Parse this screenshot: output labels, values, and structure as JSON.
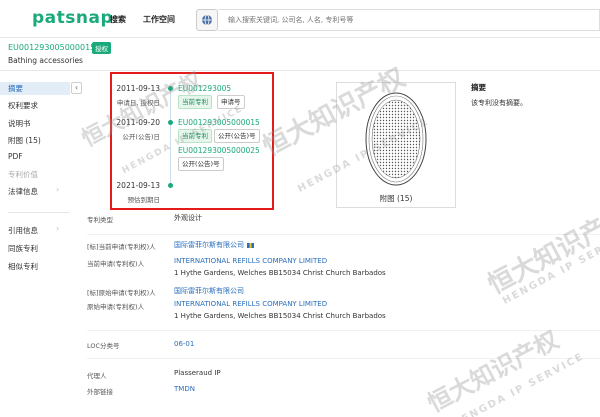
{
  "header": {
    "logo": "patsnap",
    "nav": [
      "搜索",
      "工作空间"
    ],
    "search_placeholder": "输入搜索关键词, 公司名, 人名, 专利号等"
  },
  "patent": {
    "number": "EU001293005000015",
    "status": "授权",
    "title": "Bathing accessories"
  },
  "sidebar": {
    "items": [
      "摘要",
      "权利要求",
      "说明书",
      "附图 (15)",
      "PDF",
      "专利价值",
      "法律信息",
      "引用信息",
      "同族专利",
      "相似专利"
    ],
    "active": "摘要",
    "collapse": "‹"
  },
  "timeline": {
    "events": [
      {
        "date": "2011-09-13",
        "label": "申请日, 授权日",
        "link": "EU001293005",
        "tags": [
          "当前专利",
          "申请号"
        ]
      },
      {
        "date": "2011-09-20",
        "label": "公开(公告)日",
        "link": "EU001293005000015",
        "tags": [
          "当前专利",
          "公开(公告)号"
        ],
        "link2": "EU001293005000025",
        "tags2": [
          "公开(公告)号"
        ]
      },
      {
        "date": "2021-09-13",
        "label": "预估到期日"
      }
    ]
  },
  "drawing": {
    "label": "附图 (15)"
  },
  "abstract": {
    "title": "摘要",
    "text": "该专利没有摘要。"
  },
  "info": {
    "rows": [
      {
        "label": "专利类型",
        "value": "外观设计"
      },
      {
        "label": "[标]当前申请(专利权)人",
        "value": "国际雷菲尔斯有限公司"
      },
      {
        "label": "当前申请(专利权)人",
        "value": "INTERNATIONAL REFILLS COMPANY LIMITED"
      },
      {
        "label": "",
        "value": "1 Hythe Gardens, Welches BB15034 Christ Church Barbados"
      },
      {
        "label": "[标]原始申请(专利权)人",
        "value": "国际雷菲尔斯有限公司"
      },
      {
        "label": "原始申请(专利权)人",
        "value": "INTERNATIONAL REFILLS COMPANY LIMITED"
      },
      {
        "label": "",
        "value": "1 Hythe Gardens, Welches BB15034 Christ Church Barbados"
      },
      {
        "label": "LOC分类号",
        "value": "06-01"
      },
      {
        "label": "代理人",
        "value": "Plasseraud IP"
      },
      {
        "label": "外部链接",
        "value": "TMDN"
      }
    ]
  },
  "watermark": {
    "text": "恒大知识产权",
    "sub": "HENGDA IP SERVICE"
  },
  "colors": {
    "brand": "#1aa97a",
    "link": "#2a6ebd",
    "highlight": "#e31b1b"
  }
}
